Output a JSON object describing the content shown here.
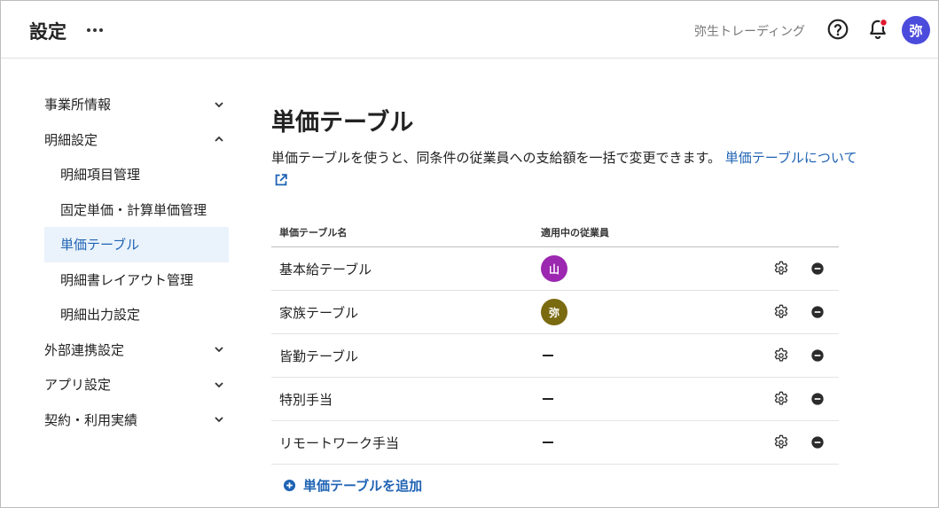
{
  "header": {
    "title": "設定",
    "company": "弥生トレーディング",
    "user_initial": "弥",
    "notification_color": "#e0182d"
  },
  "sidebar": {
    "items": [
      {
        "label": "事業所情報",
        "expanded": false
      },
      {
        "label": "明細設定",
        "expanded": true
      },
      {
        "label": "明細項目管理"
      },
      {
        "label": "固定単価・計算単価管理"
      },
      {
        "label": "単価テーブル",
        "active": true
      },
      {
        "label": "明細書レイアウト管理"
      },
      {
        "label": "明細出力設定"
      },
      {
        "label": "外部連携設定",
        "expanded": false
      },
      {
        "label": "アプリ設定",
        "expanded": false
      },
      {
        "label": "契約・利用実績",
        "expanded": false
      }
    ]
  },
  "main": {
    "title": "単価テーブル",
    "description": "単価テーブルを使うと、同条件の従業員への支給額を一括で変更できます。",
    "help_link": "単価テーブルについて",
    "columns": {
      "name": "単価テーブル名",
      "employees": "適用中の従業員"
    },
    "rows": [
      {
        "name": "基本給テーブル",
        "employee": "山",
        "avatar_color": "#9c27b0"
      },
      {
        "name": "家族テーブル",
        "employee": "弥",
        "avatar_color": "#7a6a10"
      },
      {
        "name": "皆勤テーブル",
        "employee": null
      },
      {
        "name": "特別手当",
        "employee": null
      },
      {
        "name": "リモートワーク手当",
        "employee": null
      }
    ],
    "add_label": "単価テーブルを追加"
  },
  "colors": {
    "accent": "#1f63b4",
    "active_bg": "#eaf3fb",
    "avatar_main": "#4b4bdc"
  }
}
